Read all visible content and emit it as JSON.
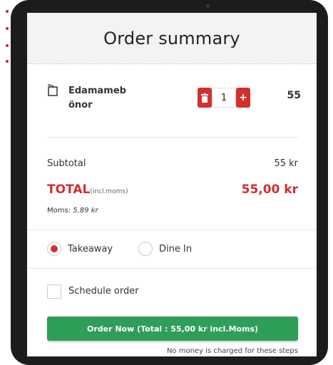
{
  "header": {
    "title": "Order summary"
  },
  "item": {
    "name": "Edamameb önor",
    "quantity": "1",
    "minus_icon": "trash-icon",
    "plus_label": "+",
    "price": "55"
  },
  "totals": {
    "subtotal_label": "Subtotal",
    "subtotal_value": "55 kr",
    "total_label": "TOTAL",
    "total_incl": "(incl.moms)",
    "total_value": "55,00 kr",
    "moms_label": "Moms:",
    "moms_value": "5,89 kr"
  },
  "order_type": {
    "options": [
      {
        "label": "Takeaway",
        "selected": true
      },
      {
        "label": "Dine In",
        "selected": false
      }
    ]
  },
  "schedule": {
    "label": "Schedule order",
    "checked": false
  },
  "order_button": {
    "label": "Order Now (Total : 55,00 kr incl.Moms)"
  },
  "footer_note": "No money is charged for these steps",
  "colors": {
    "accent_red": "#d32f2f",
    "button_green": "#2e9e58"
  }
}
